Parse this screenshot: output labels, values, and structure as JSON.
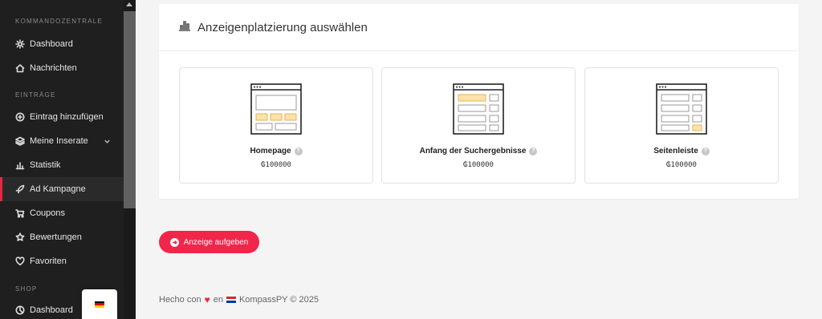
{
  "sidebar": {
    "sections": {
      "command": "KOMMANDOZENTRALE",
      "entries": "EINTRÄGE",
      "shop": "SHOP"
    },
    "items": [
      {
        "label": "Dashboard",
        "icon": "gear-icon"
      },
      {
        "label": "Nachrichten",
        "icon": "home-icon"
      },
      {
        "label": "Eintrag hinzufügen",
        "icon": "plus-circle-icon"
      },
      {
        "label": "Meine Inserate",
        "icon": "layers-icon"
      },
      {
        "label": "Statistik",
        "icon": "bar-chart-icon"
      },
      {
        "label": "Ad Kampagne",
        "icon": "rocket-icon",
        "active": true
      },
      {
        "label": "Coupons",
        "icon": "cart-icon"
      },
      {
        "label": "Bewertungen",
        "icon": "star-icon"
      },
      {
        "label": "Favoriten",
        "icon": "heart-icon"
      },
      {
        "label": "Dashboard",
        "icon": "pie-icon"
      }
    ]
  },
  "card": {
    "title": "Anzeigenplatzierung auswählen",
    "options": [
      {
        "name": "Homepage",
        "price": "₲100000"
      },
      {
        "name": "Anfang der Suchergebnisse",
        "price": "₲100000"
      },
      {
        "name": "Seitenleiste",
        "price": "₲100000"
      }
    ],
    "help_symbol": "?"
  },
  "cta": {
    "label": "Anzeige aufgeben"
  },
  "footer": {
    "before": "Hecho con",
    "heart": "♥",
    "middle": "en",
    "after": "KompassPY © 2025"
  },
  "colors": {
    "accent": "#f2254a",
    "highlight": "#fde3a7",
    "sidebar_bg": "#1f1f1f"
  }
}
